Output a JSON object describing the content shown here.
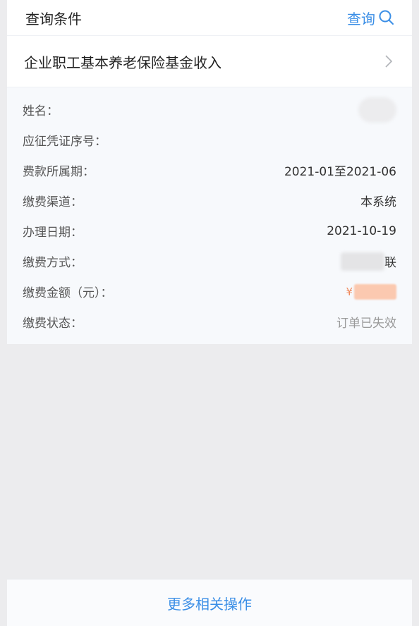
{
  "header": {
    "title": "查询条件",
    "search_label": "查询"
  },
  "category": {
    "label": "企业职工基本养老保险基金收入"
  },
  "details": [
    {
      "key": "name",
      "label": "姓名：",
      "value": ""
    },
    {
      "key": "voucher",
      "label": "应征凭证序号：",
      "value": ""
    },
    {
      "key": "period",
      "label": "费款所属期：",
      "value": "2021-01至2021-06"
    },
    {
      "key": "channel",
      "label": "缴费渠道：",
      "value": "本系统"
    },
    {
      "key": "date",
      "label": "办理日期：",
      "value": "2021-10-19"
    },
    {
      "key": "method",
      "label": "缴费方式：",
      "value": "联"
    },
    {
      "key": "amount",
      "label": "缴费金额（元）：",
      "value": "¥"
    },
    {
      "key": "status",
      "label": "缴费状态：",
      "value": "订单已失效"
    }
  ],
  "footer": {
    "more_label": "更多相关操作"
  },
  "colors": {
    "accent": "#3a8ee6",
    "background": "#ececee"
  }
}
